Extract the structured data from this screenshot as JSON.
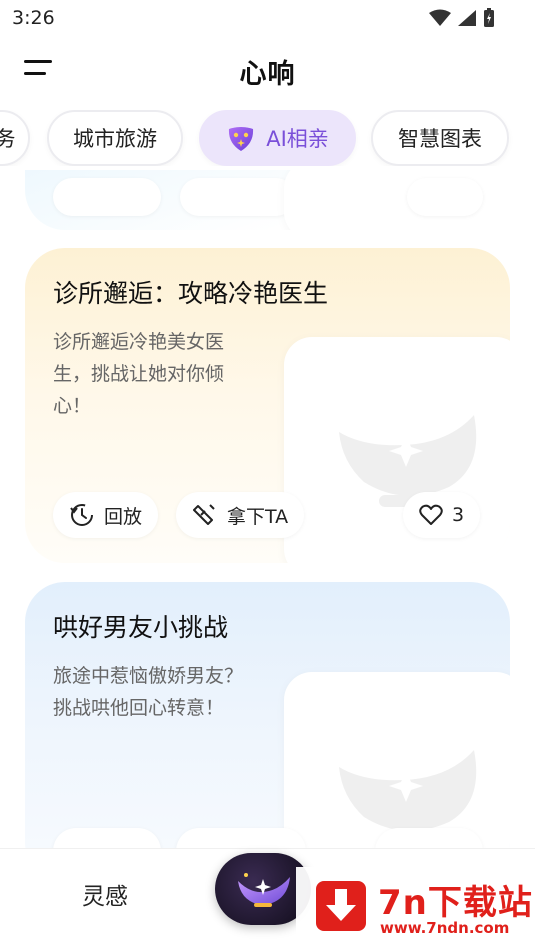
{
  "status_bar": {
    "time": "3:26"
  },
  "header": {
    "title": "心响",
    "menu_icon": "menu-icon"
  },
  "tabs": [
    {
      "label": "务",
      "active": false
    },
    {
      "label": "城市旅游",
      "active": false
    },
    {
      "label": "AI相亲",
      "active": true,
      "icon": "ai-mask-icon"
    },
    {
      "label": "智慧图表",
      "active": false
    }
  ],
  "cards": [
    {
      "title": "诊所邂逅：攻略冷艳医生",
      "description": "诊所邂逅冷艳美女医生，挑战让她对你倾心！",
      "replay_label": "回放",
      "take_label": "拿下TA",
      "likes": "3"
    },
    {
      "title": "哄好男友小挑战",
      "description": "旅途中惹恼傲娇男友？挑战哄他回心转意！"
    }
  ],
  "bottom_nav": {
    "inspire_label": "灵感",
    "center_icon": "magic-lamp-icon"
  },
  "watermark": {
    "main": "7n下载站",
    "sub": "www.7ndn.com"
  },
  "colors": {
    "accent": "#7a4fd9",
    "tab_active_bg": "#ece5fb",
    "watermark": "#e0201b"
  }
}
